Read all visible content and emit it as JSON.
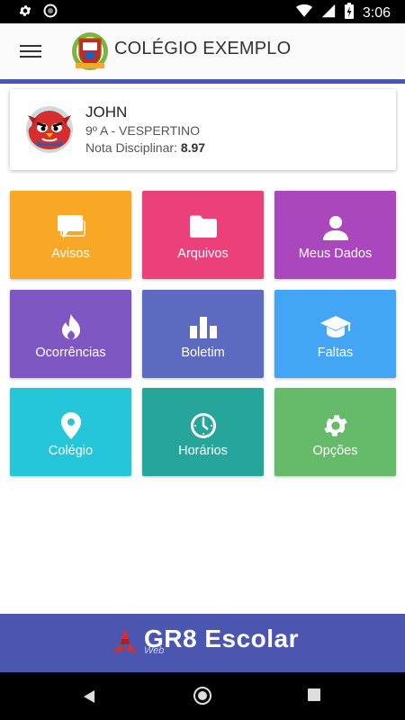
{
  "status": {
    "time": "3:06"
  },
  "header": {
    "title": "COLÉGIO EXEMPLO"
  },
  "profile": {
    "name": "JOHN",
    "class": "9º A - VESPERTINO",
    "nota_label": "Nota Disciplinar: ",
    "nota_value": "8.97"
  },
  "tiles": [
    {
      "label": "Avisos",
      "color": "#f9a825",
      "icon": "chat-icon"
    },
    {
      "label": "Arquivos",
      "color": "#ec407a",
      "icon": "folder-icon"
    },
    {
      "label": "Meus Dados",
      "color": "#ab47bc",
      "icon": "person-icon"
    },
    {
      "label": "Ocorrências",
      "color": "#7e57c2",
      "icon": "flame-icon"
    },
    {
      "label": "Boletim",
      "color": "#5c6bc0",
      "icon": "bar-chart-icon"
    },
    {
      "label": "Faltas",
      "color": "#42a5f5",
      "icon": "graduation-cap-icon"
    },
    {
      "label": "Colégio",
      "color": "#26c6da",
      "icon": "location-pin-icon"
    },
    {
      "label": "Horários",
      "color": "#26a69a",
      "icon": "clock-icon"
    },
    {
      "label": "Opções",
      "color": "#66bb6a",
      "icon": "gear-icon"
    }
  ],
  "footer": {
    "brand": "GR8 Escolar",
    "sub": "Web"
  },
  "colors": {
    "accent": "#4a56b0"
  }
}
